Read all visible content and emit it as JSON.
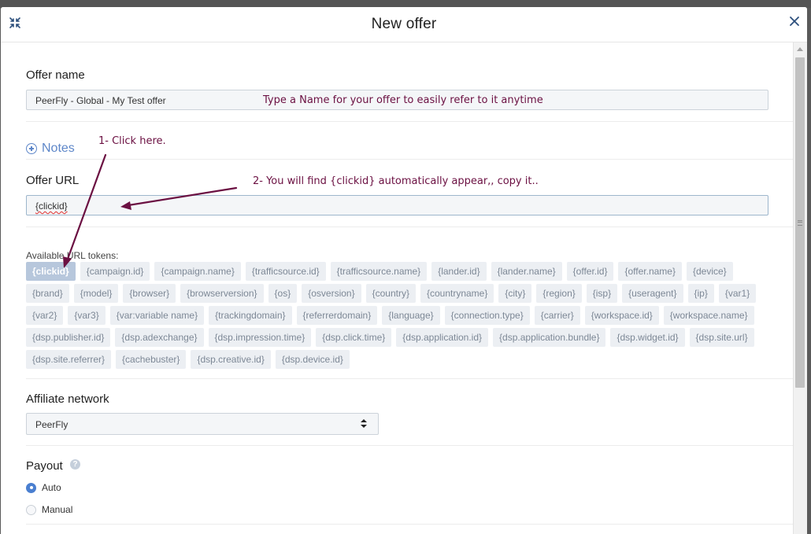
{
  "modal": {
    "title": "New offer"
  },
  "offer_name": {
    "label": "Offer name",
    "value": "PeerFly - Global - My Test offer",
    "annotation": "Type a Name for your offer to easily refer to it anytime"
  },
  "notes": {
    "label": "Notes",
    "annotation": "1- Click here."
  },
  "offer_url": {
    "label": "Offer URL",
    "value": "{clickid}",
    "annotation": "2- You will find {clickid} automatically appear,, copy it.."
  },
  "tokens": {
    "label": "Available URL tokens:",
    "rows": [
      [
        "{clickid}",
        "{campaign.id}",
        "{campaign.name}",
        "{trafficsource.id}",
        "{trafficsource.name}",
        "{lander.id}",
        "{lander.name}",
        "{offer.id}",
        "{offer.name}",
        "{device}"
      ],
      [
        "{brand}",
        "{model}",
        "{browser}",
        "{browserversion}",
        "{os}",
        "{osversion}",
        "{country}",
        "{countryname}",
        "{city}",
        "{region}",
        "{isp}",
        "{useragent}",
        "{ip}",
        "{var1}"
      ],
      [
        "{var2}",
        "{var3}",
        "{var:variable name}",
        "{trackingdomain}",
        "{referrerdomain}",
        "{language}",
        "{connection.type}",
        "{carrier}",
        "{workspace.id}",
        "{workspace.name}"
      ],
      [
        "{dsp.publisher.id}",
        "{dsp.adexchange}",
        "{dsp.impression.time}",
        "{dsp.click.time}",
        "{dsp.application.id}",
        "{dsp.application.bundle}",
        "{dsp.widget.id}",
        "{dsp.site.url}"
      ],
      [
        "{dsp.site.referrer}",
        "{cachebuster}",
        "{dsp.creative.id}",
        "{dsp.device.id}"
      ]
    ],
    "selected": "{clickid}"
  },
  "affiliate_network": {
    "label": "Affiliate network",
    "value": "PeerFly"
  },
  "payout": {
    "label": "Payout",
    "help": "?",
    "options": [
      {
        "label": "Auto",
        "checked": true
      },
      {
        "label": "Manual",
        "checked": false
      }
    ]
  },
  "colors": {
    "annotation": "#6b1042",
    "link": "#5e87c9",
    "radio_checked": "#4a7fd0",
    "token_bg": "#eceff3",
    "token_selected_bg": "#b7c7dc"
  }
}
